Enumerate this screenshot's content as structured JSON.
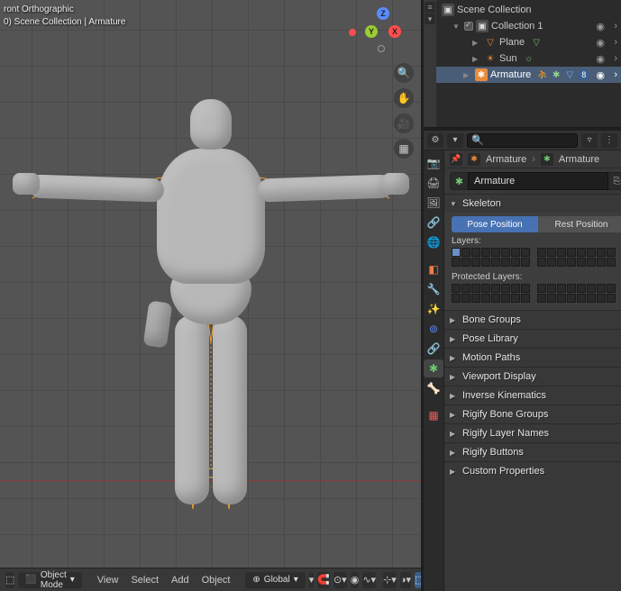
{
  "viewport": {
    "projection": "ront Orthographic",
    "info": "0) Scene Collection | Armature",
    "gizmo": {
      "z": "Z",
      "y": "Y",
      "x": "X"
    }
  },
  "footer": {
    "mode": "Object Mode",
    "menus": [
      "View",
      "Select",
      "Add",
      "Object"
    ],
    "orientation": "Global"
  },
  "outliner": {
    "root": "Scene Collection",
    "collection": "Collection 1",
    "plane": "Plane",
    "sun": "Sun",
    "armature": "Armature",
    "arm_badge": "8"
  },
  "properties": {
    "breadcrumb_a": "Armature",
    "breadcrumb_b": "Armature",
    "name_value": "Armature",
    "skeleton": {
      "title": "Skeleton",
      "pose": "Pose Position",
      "rest": "Rest Position",
      "layers_lbl": "Layers:",
      "protected_lbl": "Protected Layers:"
    },
    "panels": [
      "Bone Groups",
      "Pose Library",
      "Motion Paths",
      "Viewport Display",
      "Inverse Kinematics",
      "Rigify Bone Groups",
      "Rigify Layer Names",
      "Rigify Buttons",
      "Custom Properties"
    ]
  },
  "chart_data": null
}
